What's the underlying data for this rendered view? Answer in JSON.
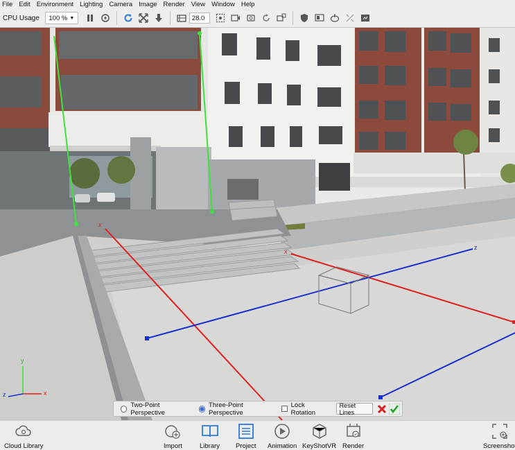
{
  "menu": [
    "File",
    "Edit",
    "Environment",
    "Lighting",
    "Camera",
    "Image",
    "Render",
    "View",
    "Window",
    "Help"
  ],
  "toolbar": {
    "cpu_label": "CPU Usage",
    "zoom_value": "100 %",
    "focal_value": "28.0"
  },
  "perspective_panel": {
    "two_point_label": "Two-Point Perspective",
    "three_point_label": "Three-Point Perspective",
    "three_point_selected": true,
    "lock_rotation_label": "Lock Rotation",
    "lock_rotation_checked": false,
    "reset_label": "Reset Lines"
  },
  "axis_gizmo": {
    "x": "x",
    "y": "y",
    "z": "z"
  },
  "guide_labels": {
    "x": "x",
    "z": "z"
  },
  "colors": {
    "x_line": "#e02020",
    "z_line": "#1a2fd0",
    "y_line": "#3ee23e",
    "accent": "#2b78d8"
  },
  "bottom_bar": {
    "cloud_library": "Cloud Library",
    "import": "Import",
    "library": "Library",
    "project": "Project",
    "animation": "Animation",
    "keyshotvr": "KeyShotVR",
    "render": "Render",
    "screenshot": "Screenshot"
  }
}
